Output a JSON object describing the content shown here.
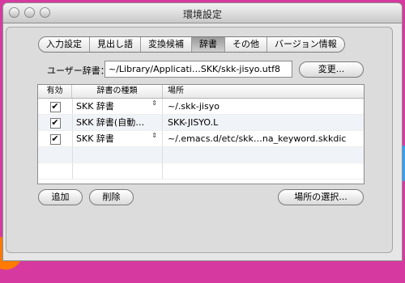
{
  "window": {
    "title": "環境設定"
  },
  "tabs": [
    {
      "label": "入力設定",
      "selected": false
    },
    {
      "label": "見出し語",
      "selected": false
    },
    {
      "label": "変換候補",
      "selected": false
    },
    {
      "label": "辞書",
      "selected": true
    },
    {
      "label": "その他",
      "selected": false
    },
    {
      "label": "バージョン情報",
      "selected": false
    }
  ],
  "user_dict": {
    "label": "ユーザー辞書：",
    "path": "~/Library/Applicati…SKK/skk-jisyo.utf8",
    "change_button": "変更..."
  },
  "table": {
    "headers": {
      "enabled": "有効",
      "type": "辞書の種類",
      "location": "場所"
    },
    "rows": [
      {
        "enabled": true,
        "type": "SKK 辞書",
        "location": "~/.skk-jisyo"
      },
      {
        "enabled": true,
        "type": "SKK 辞書(自動…",
        "location": "SKK-JISYO.L"
      },
      {
        "enabled": true,
        "type": "SKK 辞書",
        "location": "~/.emacs.d/etc/skk…na_keyword.skkdic"
      }
    ]
  },
  "buttons": {
    "add": "追加",
    "delete": "削除",
    "choose_location": "場所の選択..."
  },
  "icons": {
    "check": "✔",
    "stepper": "⇕"
  }
}
